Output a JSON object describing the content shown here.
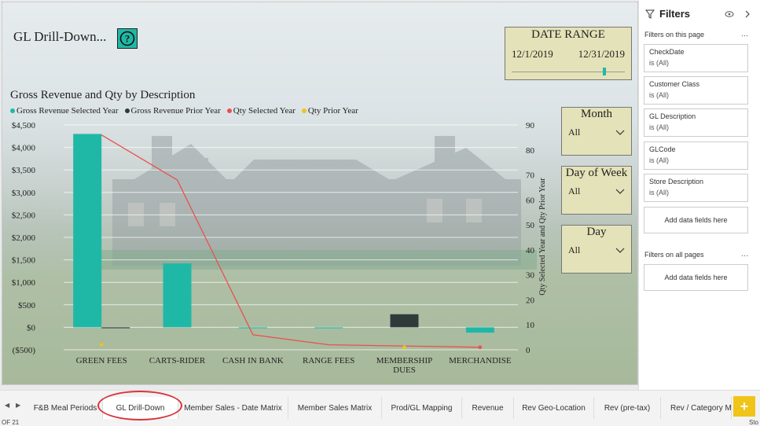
{
  "report": {
    "title": "GL Drill-Down...",
    "help_icon": "?"
  },
  "date_range": {
    "title": "DATE RANGE",
    "start": "12/1/2019",
    "end": "12/31/2019"
  },
  "slicers": [
    {
      "title": "Month",
      "value": "All"
    },
    {
      "title": "Day of Week",
      "value": "All"
    },
    {
      "title": "Day",
      "value": "All"
    }
  ],
  "chart_data": {
    "type": "bar",
    "title": "Gross Revenue and Qty by Description",
    "categories": [
      "GREEN FEES",
      "CARTS-RIDER",
      "CASH IN BANK",
      "RANGE FEES",
      "MEMBERSHIP DUES",
      "MERCHANDISE"
    ],
    "category_lines": [
      [
        "GREEN FEES"
      ],
      [
        "CARTS-RIDER"
      ],
      [
        "CASH IN BANK"
      ],
      [
        "RANGE FEES"
      ],
      [
        "MEMBERSHIP",
        "DUES"
      ],
      [
        "MERCHANDISE"
      ]
    ],
    "series": [
      {
        "name": "Gross Revenue Selected Year",
        "type": "bar",
        "color": "#1fb8a6",
        "values": [
          4300,
          1420,
          0,
          0,
          null,
          -120
        ]
      },
      {
        "name": "Gross Revenue Prior Year",
        "type": "bar",
        "color": "#2f3b3b",
        "values": [
          0,
          null,
          null,
          null,
          290,
          null
        ]
      },
      {
        "name": "Qty Selected Year",
        "type": "line",
        "color": "#e8514f",
        "values": [
          86,
          68,
          6,
          2,
          null,
          1
        ]
      },
      {
        "name": "Qty Prior Year",
        "type": "points",
        "color": "#f0c419",
        "values": [
          2,
          null,
          null,
          null,
          1,
          null
        ]
      }
    ],
    "y_left": {
      "min": -500,
      "max": 4500,
      "ticks": [
        "$4,500",
        "$4,000",
        "$3,500",
        "$3,000",
        "$2,500",
        "$2,000",
        "$1,500",
        "$1,000",
        "$500",
        "$0",
        "($500)"
      ]
    },
    "y_right": {
      "label": "Qty Selected Year and Qty Prior Year",
      "min": 0,
      "max": 90,
      "ticks": [
        "90",
        "80",
        "70",
        "60",
        "50",
        "40",
        "30",
        "20",
        "10",
        "0"
      ]
    },
    "grid": true,
    "legend_position": "top-left"
  },
  "filters": {
    "title": "Filters",
    "on_page_label": "Filters on this page",
    "cards": [
      {
        "name": "CheckDate",
        "state": "is (All)"
      },
      {
        "name": "Customer Class",
        "state": "is (All)"
      },
      {
        "name": "GL Description",
        "state": "is (All)"
      },
      {
        "name": "GLCode",
        "state": "is (All)"
      },
      {
        "name": "Store Description",
        "state": "is (All)"
      }
    ],
    "add_fields_label": "Add data fields here",
    "all_pages_label": "Filters on all pages",
    "add_fields_label_all": "Add data fields here",
    "more": "..."
  },
  "tabs": [
    {
      "label": "F&B Meal Periods"
    },
    {
      "label": "GL Drill-Down"
    },
    {
      "label": "Member Sales - Date Matrix"
    },
    {
      "label": "Member Sales Matrix"
    },
    {
      "label": "Prod/GL Mapping"
    },
    {
      "label": "Revenue"
    },
    {
      "label": "Rev Geo-Location"
    },
    {
      "label": "Rev (pre-tax)"
    },
    {
      "label": "Rev / Category Mat"
    }
  ],
  "footer": {
    "left": "OF 21",
    "right": "Sto"
  }
}
